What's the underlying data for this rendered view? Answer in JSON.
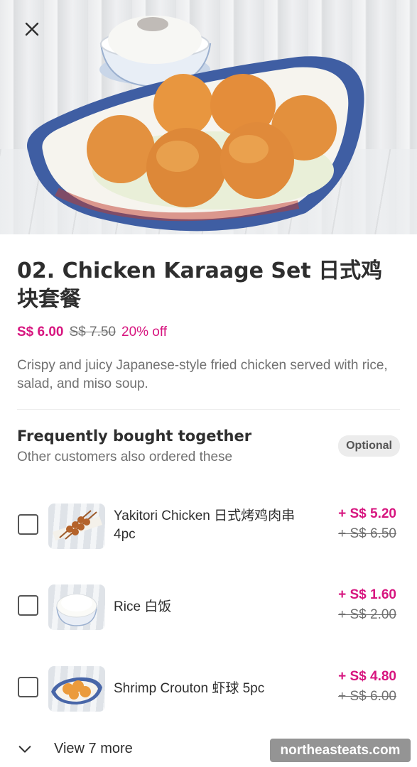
{
  "header": {
    "close_icon": "close-icon"
  },
  "product": {
    "title": "02. Chicken Karaage Set 日式鸡块套餐",
    "price_now": "S$ 6.00",
    "price_old": "S$ 7.50",
    "discount": "20% off",
    "description": "Crispy and juicy Japanese-style fried chicken served with rice, salad, and miso soup."
  },
  "fbt": {
    "title": "Frequently bought together",
    "subtitle": "Other customers also ordered these",
    "optional_badge": "Optional",
    "items": [
      {
        "name": "Yakitori Chicken 日式烤鸡肉串 4pc",
        "price_new": "+ S$ 5.20",
        "price_old": "+ S$ 6.50",
        "checked": false
      },
      {
        "name": "Rice 白饭",
        "price_new": "+ S$ 1.60",
        "price_old": "+ S$ 2.00",
        "checked": false
      },
      {
        "name": "Shrimp Crouton 虾球 5pc",
        "price_new": "+ S$ 4.80",
        "price_old": "+ S$ 6.00",
        "checked": false
      }
    ],
    "view_more": "View 7 more"
  },
  "watermark": "northeasteats.com",
  "colors": {
    "accent": "#d7157f",
    "text": "#2e2e2e",
    "muted": "#707070"
  }
}
